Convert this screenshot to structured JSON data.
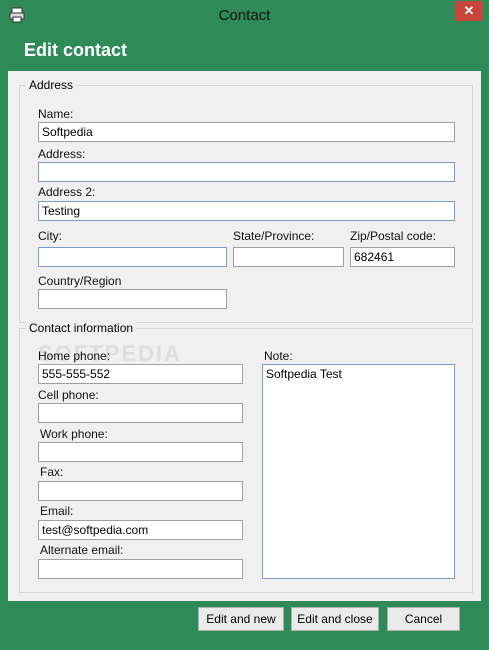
{
  "window": {
    "title": "Contact",
    "close_glyph": "✕",
    "icon": "printer-icon",
    "accent_color": "#2e8b57",
    "close_color": "#c7463b"
  },
  "header": {
    "title": "Edit contact"
  },
  "address": {
    "legend": "Address",
    "name": {
      "label": "Name:",
      "value": "Softpedia"
    },
    "address": {
      "label": "Address:",
      "value": ""
    },
    "address2": {
      "label": "Address 2:",
      "value": "Testing"
    },
    "city": {
      "label": "City:",
      "value": ""
    },
    "state": {
      "label": "State/Province:",
      "value": ""
    },
    "zip": {
      "label": "Zip/Postal code:",
      "value": "682461"
    },
    "country": {
      "label": "Country/Region",
      "value": ""
    }
  },
  "contact": {
    "legend": "Contact information",
    "home_phone": {
      "label": "Home phone:",
      "value": "555-555-552"
    },
    "cell_phone": {
      "label": "Cell phone:",
      "value": ""
    },
    "work_phone": {
      "label": "Work phone:",
      "value": ""
    },
    "fax": {
      "label": "Fax:",
      "value": ""
    },
    "email": {
      "label": "Email:",
      "value": "test@softpedia.com"
    },
    "alt_email": {
      "label": "Alternate email:",
      "value": ""
    },
    "note": {
      "label": "Note:",
      "value": "Softpedia Test"
    }
  },
  "footer": {
    "edit_new": "Edit and new",
    "edit_close": "Edit and close",
    "cancel": "Cancel"
  }
}
